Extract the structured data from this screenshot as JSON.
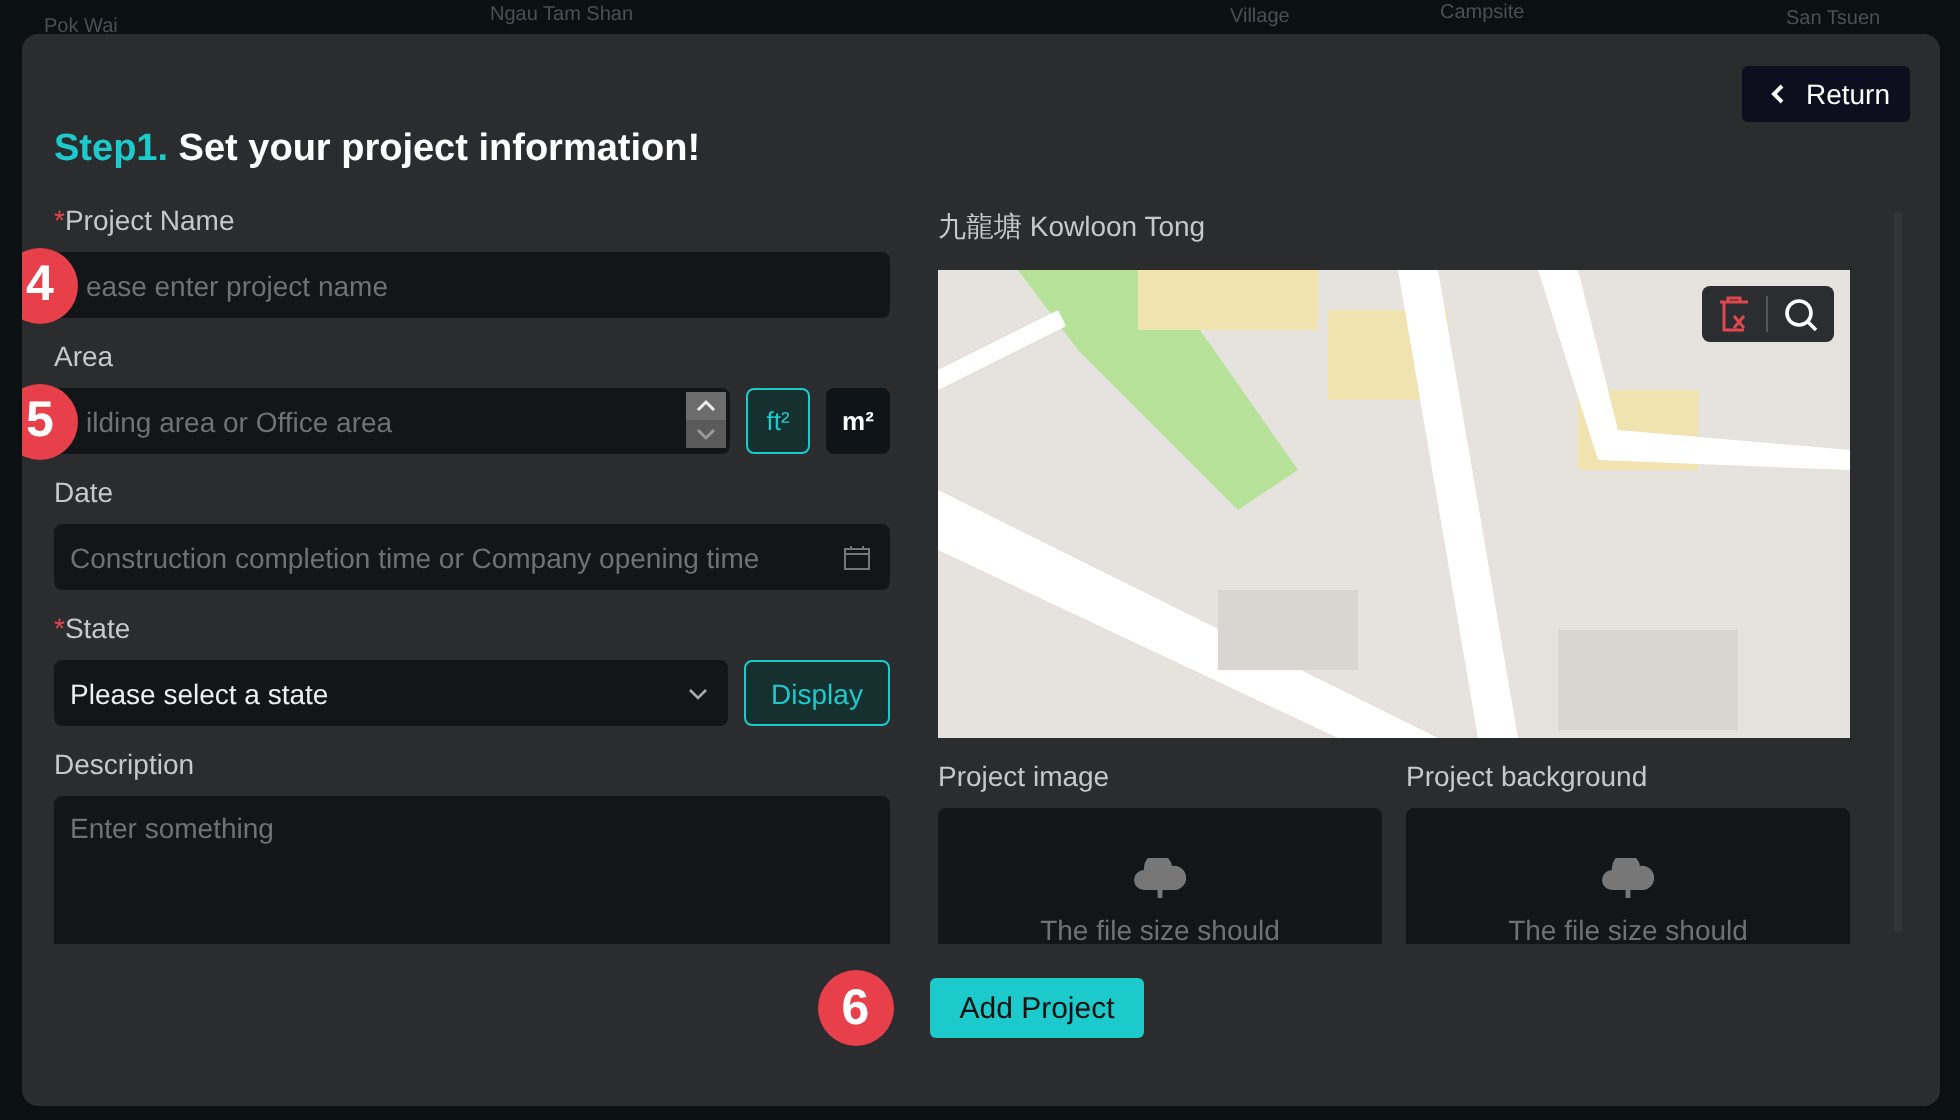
{
  "background_map": {
    "labels": [
      "Pok Wai",
      "Ngau Tam Shan",
      "Village",
      "Campsite",
      "San Tsuen"
    ]
  },
  "dialog": {
    "return_button": "Return",
    "heading": {
      "step": "Step1.",
      "title": "Set your project information!"
    },
    "fields": [
      {
        "kind": "text",
        "label": "Project Name",
        "required_mark": "*",
        "placeholder": "ease enter project name",
        "marker": "4"
      },
      {
        "kind": "number",
        "label": "Area",
        "placeholder": "ilding area or Office area",
        "marker": "5",
        "units": [
          {
            "label": "ft²",
            "selected": true
          },
          {
            "label": "m²",
            "selected": false
          }
        ]
      },
      {
        "kind": "date",
        "label": "Date",
        "placeholder": "Construction completion time or Company opening time"
      },
      {
        "kind": "select",
        "label": "State",
        "required_mark": "*",
        "value": "Please select a state",
        "button": "Display"
      },
      {
        "kind": "textarea",
        "label": "Description",
        "placeholder": "Enter something"
      }
    ],
    "map": {
      "title": "九龍塘 Kowloon Tong"
    },
    "uploads": [
      {
        "label": "Project image",
        "hint": "The file size should"
      },
      {
        "label": "Project background",
        "hint": "The file size should"
      }
    ],
    "submit": {
      "label": "Add Project",
      "marker": "6"
    }
  }
}
